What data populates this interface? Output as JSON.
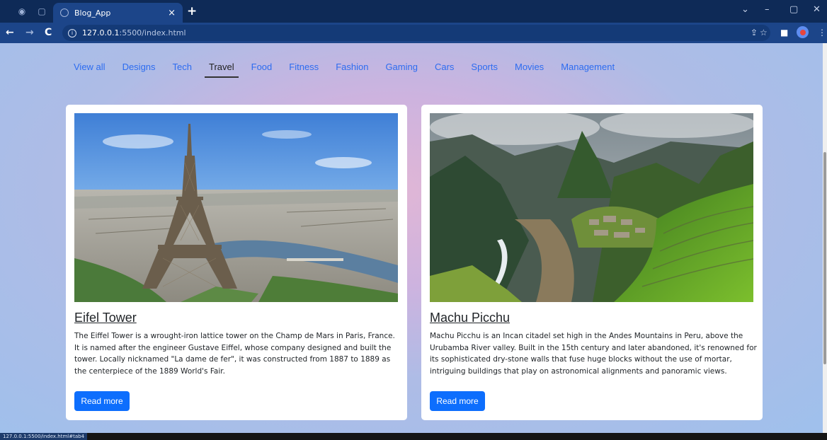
{
  "browser": {
    "tab_title": "Blog_App",
    "tab_close": "×",
    "new_tab": "+",
    "url_host": "127.0.0.1",
    "url_path": ":5500/index.html",
    "status_url": "127.0.0.1:5500/index.html#tab4",
    "accent": "#1c4589"
  },
  "nav": {
    "categories": [
      "View all",
      "Designs",
      "Tech",
      "Travel",
      "Food",
      "Fitness",
      "Fashion",
      "Gaming",
      "Cars",
      "Sports",
      "Movies",
      "Management"
    ],
    "active": "Travel"
  },
  "cards": [
    {
      "title": "Eifel Tower",
      "text": "The Eiffel Tower is a wrought-iron lattice tower on the Champ de Mars in Paris, France. It is named after the engineer Gustave Eiffel, whose company designed and built the tower. Locally nicknamed \"La dame de fer\", it was constructed from 1887 to 1889 as the centerpiece of the 1889 World's Fair.",
      "button": "Read more"
    },
    {
      "title": "Machu Picchu",
      "text": "Machu Picchu is an Incan citadel set high in the Andes Mountains in Peru, above the Urubamba River valley. Built in the 15th century and later abandoned, it's renowned for its sophisticated dry-stone walls that fuse huge blocks without the use of mortar, intriguing buildings that play on astronomical alignments and panoramic views.",
      "button": "Read more"
    }
  ],
  "colors": {
    "button": "#0d6efd",
    "link": "#2d6cf0"
  }
}
